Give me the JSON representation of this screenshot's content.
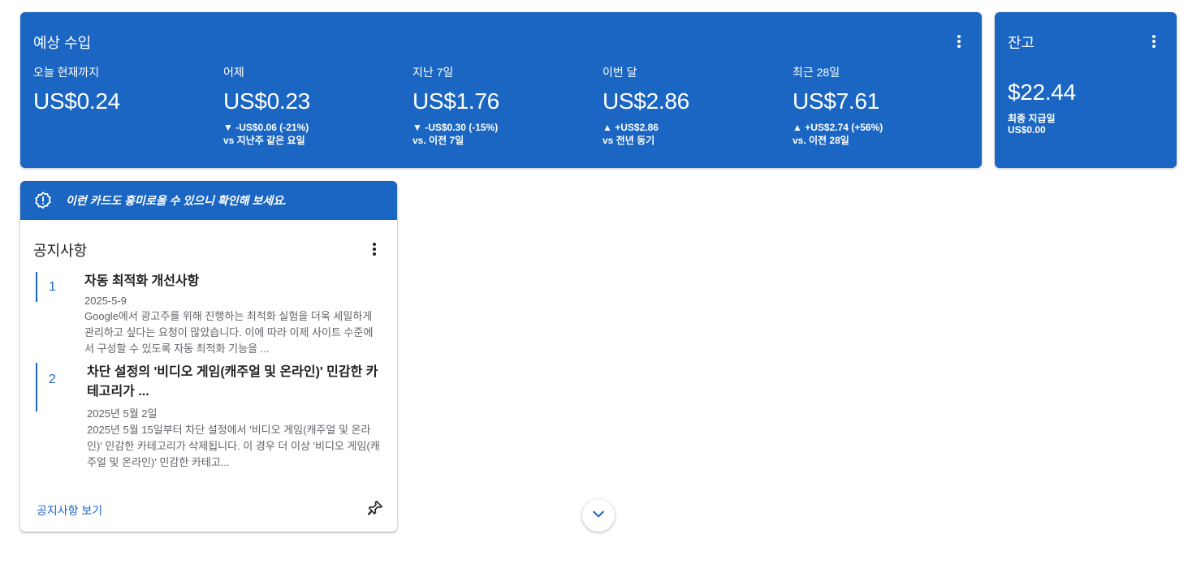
{
  "earnings": {
    "title": "예상 수입",
    "metrics": [
      {
        "label": "오늘 현재까지",
        "value": "US$0.24",
        "change": "",
        "compare": ""
      },
      {
        "label": "어제",
        "value": "US$0.23",
        "change": "▼ -US$0.06 (-21%)",
        "compare": "vs 지난주 같은 요일"
      },
      {
        "label": "지난 7일",
        "value": "US$1.76",
        "change": "▼ -US$0.30 (-15%)",
        "compare": "vs. 이전 7일"
      },
      {
        "label": "이번 달",
        "value": "US$2.86",
        "change": "▲ +US$2.86",
        "compare": "vs 전년 동기"
      },
      {
        "label": "최근 28일",
        "value": "US$7.61",
        "change": "▲ +US$2.74 (+56%)",
        "compare": "vs. 이전 28일"
      }
    ]
  },
  "balance": {
    "title": "잔고",
    "value": "$22.44",
    "last_payment_label": "최종 지급일",
    "last_payment_value": "US$0.00"
  },
  "notices": {
    "banner": "이런 카드도 흥미로울 수 있으니 확인해 보세요.",
    "title": "공지사항",
    "items": [
      {
        "number": "1",
        "title": "자동 최적화 개선사항",
        "date": "2025-5-9",
        "description": "Google에서 광고주를 위해 진행하는 최적화 실험을 더욱 세밀하게 관리하고 싶다는 요청이 많았습니다. 이에 따라 이제 사이트 수준에서 구성할 수 있도록 자동 최적화 기능을 ..."
      },
      {
        "number": "2",
        "title": "차단 설정의 '비디오 게임(캐주얼 및 온라인)' 민감한 카테고리가 ...",
        "date": "2025년 5월 2일",
        "description": "2025년 5월 15일부터 차단 설정에서 '비디오 게임(캐주얼 및 온라인)' 민감한 카테고리가 삭제됩니다. 이 경우 더 이상 '비디오 게임(캐주얼 및 온라인)' 민감한 카테고..."
      }
    ],
    "view_link": "공지사항 보기"
  },
  "icons": {
    "more": "more-vert-icon",
    "alert": "alert-badge-icon",
    "pin": "pin-icon",
    "scroll": "chevron-down-icon"
  },
  "colors": {
    "primary": "#1a66c2",
    "text": "#202124",
    "muted": "#5f6368"
  }
}
